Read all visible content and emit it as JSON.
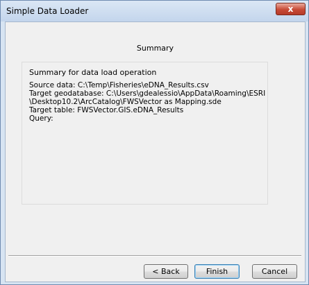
{
  "window": {
    "title": "Simple Data Loader",
    "close_symbol": "x"
  },
  "page": {
    "heading": "Summary"
  },
  "summary": {
    "header": "Summary for data load operation",
    "lines": [
      "Source data: C:\\Temp\\Fisheries\\eDNA_Results.csv",
      "Target geodatabase: C:\\Users\\gdealessio\\AppData\\Roaming\\ESRI",
      "\\Desktop10.2\\ArcCatalog\\FWSVector as Mapping.sde",
      "Target table: FWSVector.GIS.eDNA_Results",
      "Query:"
    ]
  },
  "buttons": {
    "back": "< Back",
    "finish": "Finish",
    "cancel": "Cancel"
  },
  "colors": {
    "frame": "#d7e4f2",
    "client": "#f0f0f0",
    "close_button": "#c74a36"
  }
}
